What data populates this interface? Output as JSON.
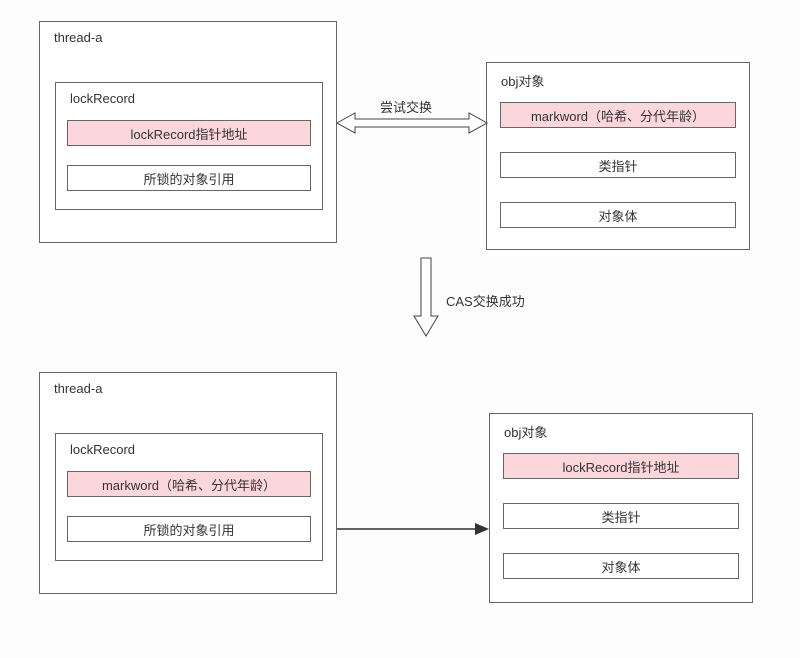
{
  "top": {
    "thread": {
      "title": "thread-a",
      "lockRecord": {
        "title": "lockRecord",
        "cell1": "lockRecord指针地址",
        "cell2": "所锁的对象引用"
      }
    },
    "obj": {
      "title": "obj对象",
      "cell1": "markword（哈希、分代年龄）",
      "cell2": "类指针",
      "cell3": "对象体"
    },
    "swapLabel": "尝试交换"
  },
  "middle": {
    "casLabel": "CAS交换成功"
  },
  "bottom": {
    "thread": {
      "title": "thread-a",
      "lockRecord": {
        "title": "lockRecord",
        "cell1": "markword（哈希、分代年龄）",
        "cell2": "所锁的对象引用"
      }
    },
    "obj": {
      "title": "obj对象",
      "cell1": "lockRecord指针地址",
      "cell2": "类指针",
      "cell3": "对象体"
    }
  }
}
